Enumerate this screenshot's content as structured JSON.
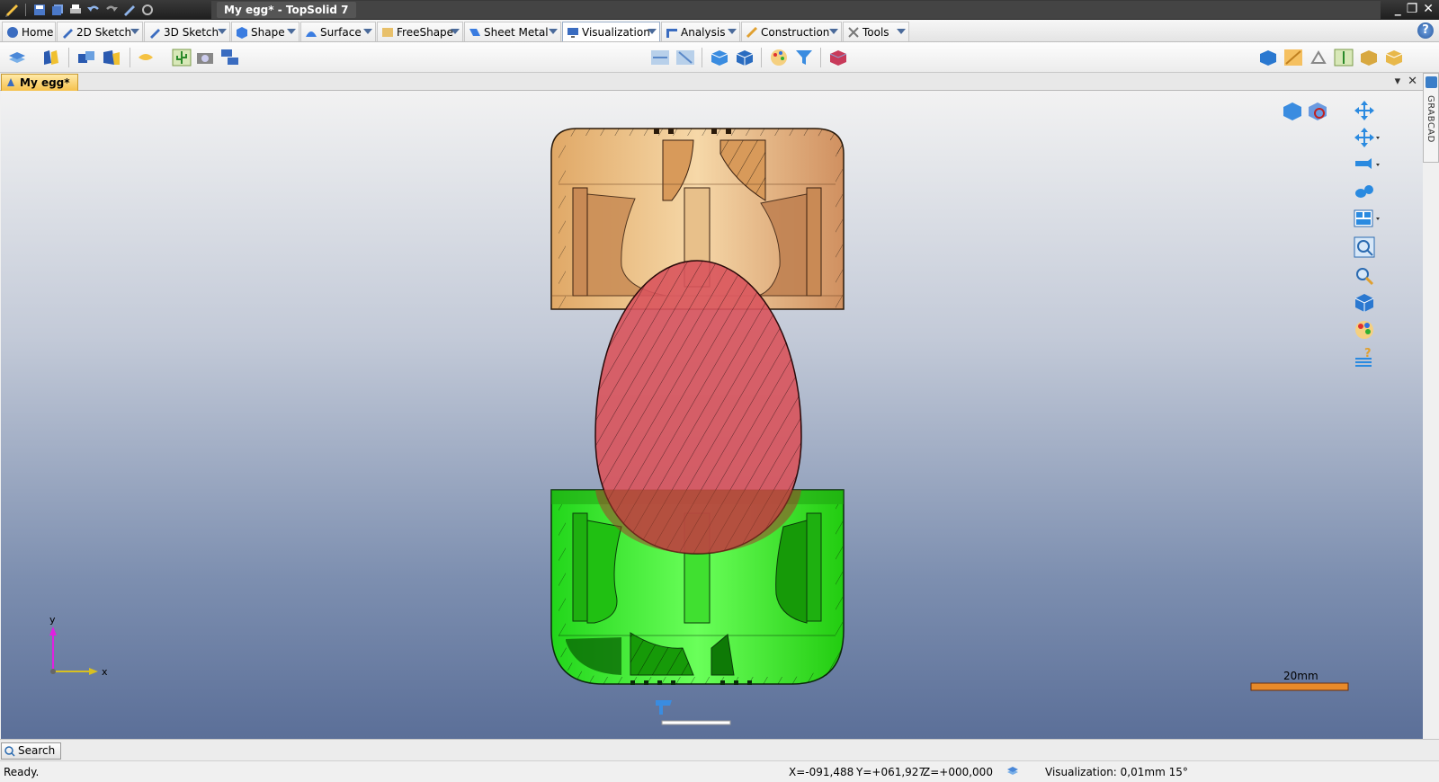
{
  "window": {
    "title": "My egg* - TopSolid 7"
  },
  "ribbon": {
    "tabs": [
      {
        "label": "Home"
      },
      {
        "label": "2D Sketch"
      },
      {
        "label": "3D Sketch"
      },
      {
        "label": "Shape"
      },
      {
        "label": "Surface"
      },
      {
        "label": "FreeShape"
      },
      {
        "label": "Sheet Metal"
      },
      {
        "label": "Visualization"
      },
      {
        "label": "Analysis"
      },
      {
        "label": "Construction"
      },
      {
        "label": "Tools"
      }
    ],
    "active_tab": "Visualization"
  },
  "document": {
    "tab_label": "My egg*"
  },
  "side_panel": {
    "label": "GRABCAD"
  },
  "viewport": {
    "axis": {
      "x_label": "x",
      "y_label": "y"
    },
    "scale_label": "20mm"
  },
  "search": {
    "label": "Search"
  },
  "status": {
    "message": "Ready.",
    "x": "X=-091,488",
    "y": "Y=+061,927",
    "z": "Z=+000,000",
    "visualization": "Visualization: 0,01mm 15°"
  },
  "colors": {
    "top_part": "#e8b27a",
    "egg": "#d9545c",
    "bottom_part": "#33ff1a",
    "scale_bar": "#e88a2a"
  }
}
